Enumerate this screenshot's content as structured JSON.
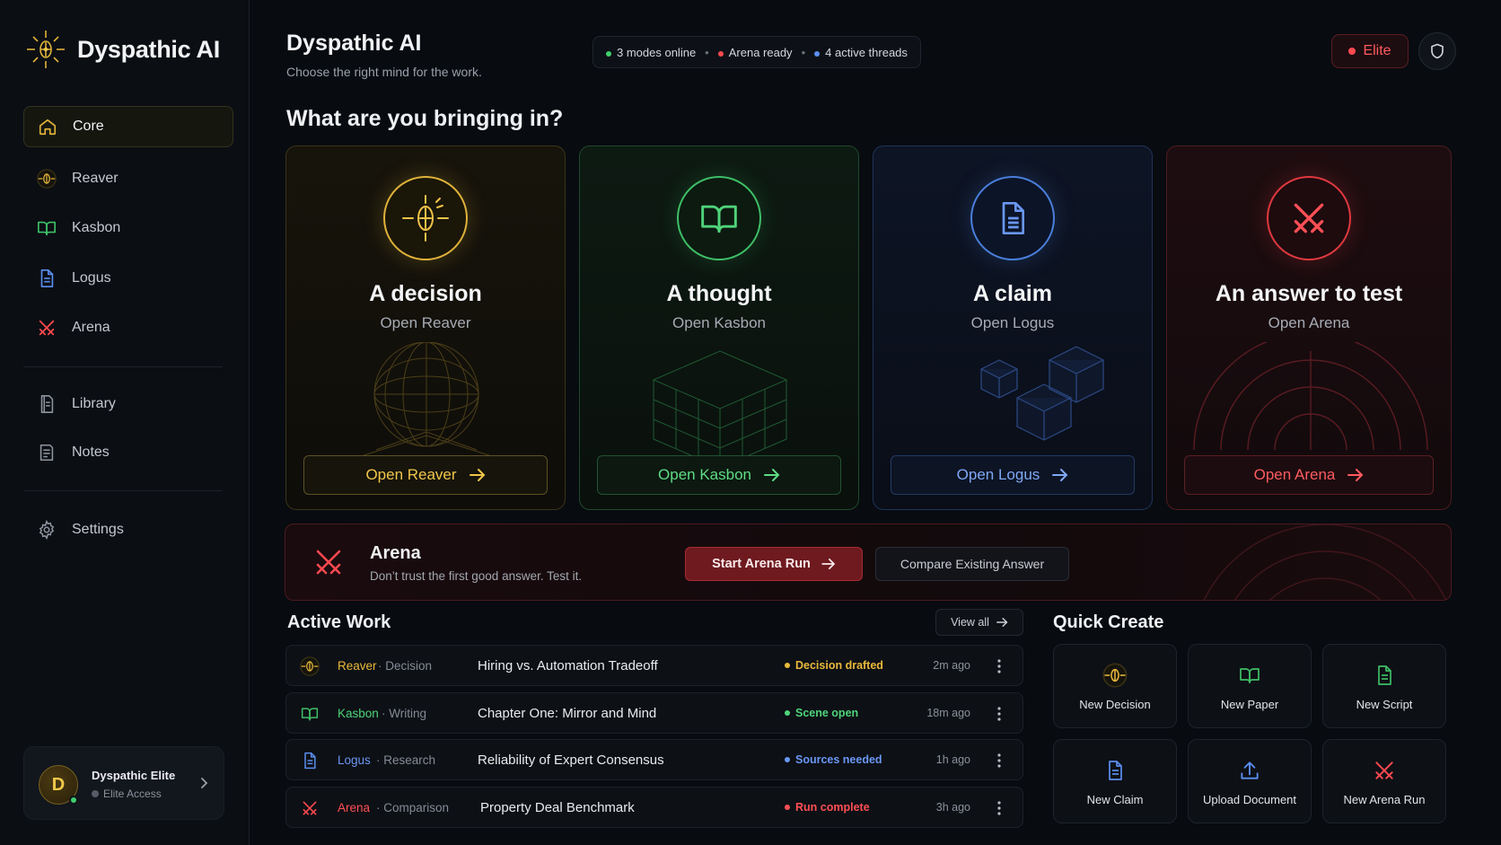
{
  "brand": {
    "name": "Dyspathic AI"
  },
  "sidebar": {
    "items": [
      {
        "label": "Core",
        "icon": "home-icon"
      },
      {
        "label": "Reaver",
        "icon": "reaver-icon"
      },
      {
        "label": "Kasbon",
        "icon": "book-icon"
      },
      {
        "label": "Logus",
        "icon": "document-icon"
      },
      {
        "label": "Arena",
        "icon": "crossed-swords-icon"
      },
      {
        "label": "Library",
        "icon": "library-icon"
      },
      {
        "label": "Notes",
        "icon": "notes-icon"
      },
      {
        "label": "Settings",
        "icon": "gear-icon"
      }
    ],
    "user": {
      "initial": "D",
      "name": "Dyspathic Elite",
      "tier": "Elite Access"
    }
  },
  "header": {
    "title": "Dyspathic AI",
    "subtitle": "Choose the right mind for the work.",
    "status": [
      {
        "text": "3 modes online",
        "color": "#3fcf6b"
      },
      {
        "text": "Arena ready",
        "color": "#ff4a50"
      },
      {
        "text": "4 active threads",
        "color": "#5b8ef0"
      }
    ],
    "badge": "Elite"
  },
  "prompt": "What are you bringing in?",
  "modes": [
    {
      "title": "A decision",
      "subtitle": "Open Reaver",
      "button": "Open Reaver",
      "accent": "#e0b23a"
    },
    {
      "title": "A thought",
      "subtitle": "Open Kasbon",
      "button": "Open Kasbon",
      "accent": "#3fbf67"
    },
    {
      "title": "A claim",
      "subtitle": "Open Logus",
      "button": "Open Logus",
      "accent": "#4a7fdc"
    },
    {
      "title": "An answer to test",
      "subtitle": "Open Arena",
      "button": "Open Arena",
      "accent": "#e0393f"
    }
  ],
  "arena_banner": {
    "title": "Arena",
    "subtitle": "Don’t trust the first good answer. Test it.",
    "primary": "Start Arena Run",
    "secondary": "Compare Existing Answer"
  },
  "active_work": {
    "title": "Active Work",
    "view_all": "View all",
    "rows": [
      {
        "mode": "Reaver",
        "type": "Decision",
        "title": "Hiring vs. Automation Tradeoff",
        "status": "Decision drafted",
        "time": "2m ago",
        "color": "#e9b93c",
        "icon": "reaver-icon"
      },
      {
        "mode": "Kasbon",
        "type": "Writing",
        "title": "Chapter One: Mirror and Mind",
        "status": "Scene open",
        "time": "18m ago",
        "color": "#4fd47a",
        "icon": "book-icon"
      },
      {
        "mode": "Logus",
        "type": "Research",
        "title": "Reliability of Expert Consensus",
        "status": "Sources needed",
        "time": "1h ago",
        "color": "#6a97f2",
        "icon": "document-icon"
      },
      {
        "mode": "Arena",
        "type": "Comparison",
        "title": "Property Deal Benchmark",
        "status": "Run complete",
        "time": "3h ago",
        "color": "#ff4f55",
        "icon": "crossed-swords-icon"
      }
    ]
  },
  "quick_create": {
    "title": "Quick Create",
    "items": [
      {
        "label": "New Decision",
        "icon": "reaver-icon"
      },
      {
        "label": "New Paper",
        "icon": "book-icon"
      },
      {
        "label": "New Script",
        "icon": "script-icon"
      },
      {
        "label": "New Claim",
        "icon": "document-icon"
      },
      {
        "label": "Upload Document",
        "icon": "upload-icon"
      },
      {
        "label": "New Arena Run",
        "icon": "crossed-swords-icon"
      }
    ]
  }
}
